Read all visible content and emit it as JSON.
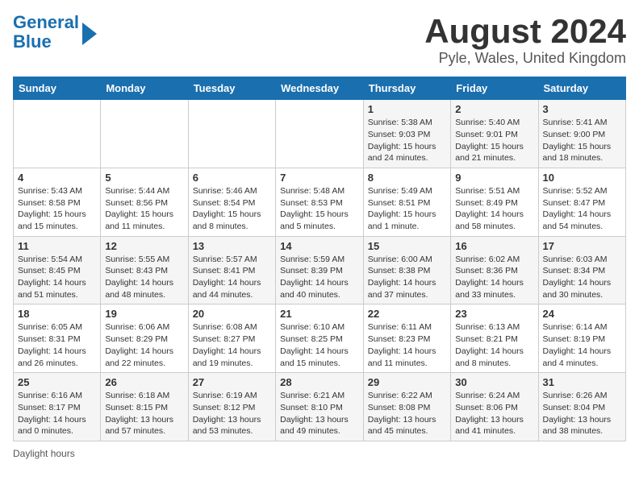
{
  "header": {
    "logo_line1": "General",
    "logo_line2": "Blue",
    "main_title": "August 2024",
    "sub_title": "Pyle, Wales, United Kingdom"
  },
  "calendar": {
    "days_of_week": [
      "Sunday",
      "Monday",
      "Tuesday",
      "Wednesday",
      "Thursday",
      "Friday",
      "Saturday"
    ],
    "weeks": [
      [
        {
          "day": "",
          "info": ""
        },
        {
          "day": "",
          "info": ""
        },
        {
          "day": "",
          "info": ""
        },
        {
          "day": "",
          "info": ""
        },
        {
          "day": "1",
          "info": "Sunrise: 5:38 AM\nSunset: 9:03 PM\nDaylight: 15 hours and 24 minutes."
        },
        {
          "day": "2",
          "info": "Sunrise: 5:40 AM\nSunset: 9:01 PM\nDaylight: 15 hours and 21 minutes."
        },
        {
          "day": "3",
          "info": "Sunrise: 5:41 AM\nSunset: 9:00 PM\nDaylight: 15 hours and 18 minutes."
        }
      ],
      [
        {
          "day": "4",
          "info": "Sunrise: 5:43 AM\nSunset: 8:58 PM\nDaylight: 15 hours and 15 minutes."
        },
        {
          "day": "5",
          "info": "Sunrise: 5:44 AM\nSunset: 8:56 PM\nDaylight: 15 hours and 11 minutes."
        },
        {
          "day": "6",
          "info": "Sunrise: 5:46 AM\nSunset: 8:54 PM\nDaylight: 15 hours and 8 minutes."
        },
        {
          "day": "7",
          "info": "Sunrise: 5:48 AM\nSunset: 8:53 PM\nDaylight: 15 hours and 5 minutes."
        },
        {
          "day": "8",
          "info": "Sunrise: 5:49 AM\nSunset: 8:51 PM\nDaylight: 15 hours and 1 minute."
        },
        {
          "day": "9",
          "info": "Sunrise: 5:51 AM\nSunset: 8:49 PM\nDaylight: 14 hours and 58 minutes."
        },
        {
          "day": "10",
          "info": "Sunrise: 5:52 AM\nSunset: 8:47 PM\nDaylight: 14 hours and 54 minutes."
        }
      ],
      [
        {
          "day": "11",
          "info": "Sunrise: 5:54 AM\nSunset: 8:45 PM\nDaylight: 14 hours and 51 minutes."
        },
        {
          "day": "12",
          "info": "Sunrise: 5:55 AM\nSunset: 8:43 PM\nDaylight: 14 hours and 48 minutes."
        },
        {
          "day": "13",
          "info": "Sunrise: 5:57 AM\nSunset: 8:41 PM\nDaylight: 14 hours and 44 minutes."
        },
        {
          "day": "14",
          "info": "Sunrise: 5:59 AM\nSunset: 8:39 PM\nDaylight: 14 hours and 40 minutes."
        },
        {
          "day": "15",
          "info": "Sunrise: 6:00 AM\nSunset: 8:38 PM\nDaylight: 14 hours and 37 minutes."
        },
        {
          "day": "16",
          "info": "Sunrise: 6:02 AM\nSunset: 8:36 PM\nDaylight: 14 hours and 33 minutes."
        },
        {
          "day": "17",
          "info": "Sunrise: 6:03 AM\nSunset: 8:34 PM\nDaylight: 14 hours and 30 minutes."
        }
      ],
      [
        {
          "day": "18",
          "info": "Sunrise: 6:05 AM\nSunset: 8:31 PM\nDaylight: 14 hours and 26 minutes."
        },
        {
          "day": "19",
          "info": "Sunrise: 6:06 AM\nSunset: 8:29 PM\nDaylight: 14 hours and 22 minutes."
        },
        {
          "day": "20",
          "info": "Sunrise: 6:08 AM\nSunset: 8:27 PM\nDaylight: 14 hours and 19 minutes."
        },
        {
          "day": "21",
          "info": "Sunrise: 6:10 AM\nSunset: 8:25 PM\nDaylight: 14 hours and 15 minutes."
        },
        {
          "day": "22",
          "info": "Sunrise: 6:11 AM\nSunset: 8:23 PM\nDaylight: 14 hours and 11 minutes."
        },
        {
          "day": "23",
          "info": "Sunrise: 6:13 AM\nSunset: 8:21 PM\nDaylight: 14 hours and 8 minutes."
        },
        {
          "day": "24",
          "info": "Sunrise: 6:14 AM\nSunset: 8:19 PM\nDaylight: 14 hours and 4 minutes."
        }
      ],
      [
        {
          "day": "25",
          "info": "Sunrise: 6:16 AM\nSunset: 8:17 PM\nDaylight: 14 hours and 0 minutes."
        },
        {
          "day": "26",
          "info": "Sunrise: 6:18 AM\nSunset: 8:15 PM\nDaylight: 13 hours and 57 minutes."
        },
        {
          "day": "27",
          "info": "Sunrise: 6:19 AM\nSunset: 8:12 PM\nDaylight: 13 hours and 53 minutes."
        },
        {
          "day": "28",
          "info": "Sunrise: 6:21 AM\nSunset: 8:10 PM\nDaylight: 13 hours and 49 minutes."
        },
        {
          "day": "29",
          "info": "Sunrise: 6:22 AM\nSunset: 8:08 PM\nDaylight: 13 hours and 45 minutes."
        },
        {
          "day": "30",
          "info": "Sunrise: 6:24 AM\nSunset: 8:06 PM\nDaylight: 13 hours and 41 minutes."
        },
        {
          "day": "31",
          "info": "Sunrise: 6:26 AM\nSunset: 8:04 PM\nDaylight: 13 hours and 38 minutes."
        }
      ]
    ]
  },
  "footer": {
    "text": "Daylight hours"
  }
}
